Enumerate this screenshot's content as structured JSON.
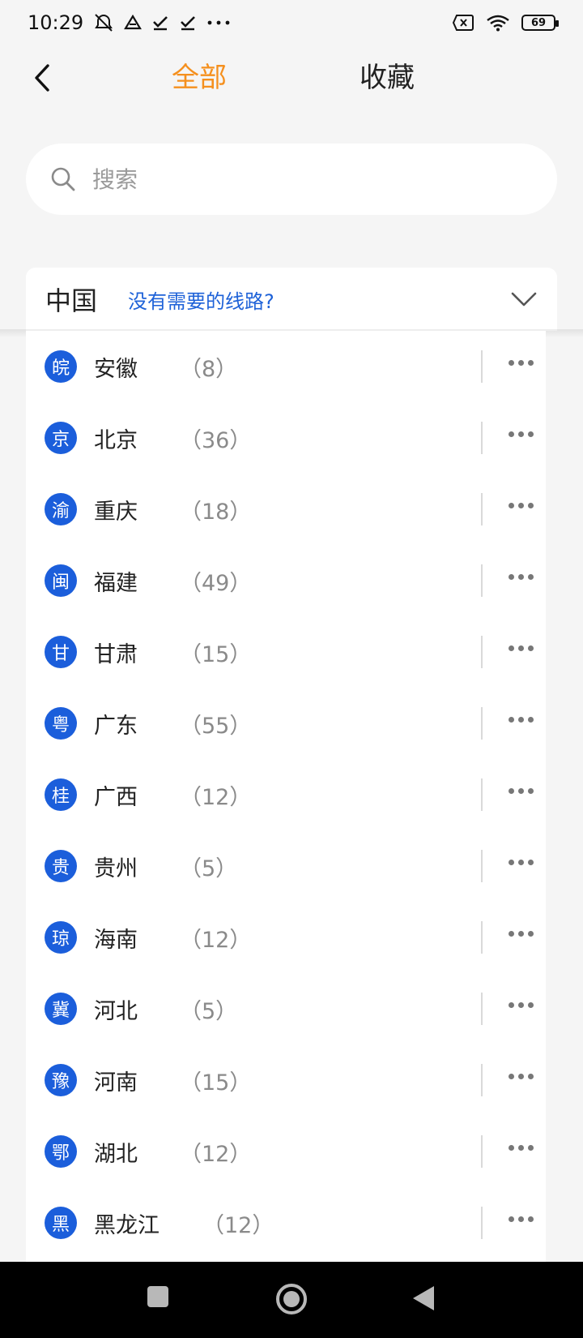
{
  "status_bar": {
    "time": "10:29",
    "battery": "69",
    "icons": [
      "alarm-off-icon",
      "drive-icon",
      "check-icon",
      "check-icon",
      "more-dots-icon",
      "sim-x-icon",
      "wifi-icon",
      "battery-icon"
    ]
  },
  "header": {
    "back_icon": "back-arrow-icon",
    "tabs": [
      {
        "label": "全部",
        "active": true
      },
      {
        "label": "收藏",
        "active": false
      }
    ],
    "active_color": "#f5901e"
  },
  "search": {
    "placeholder": "搜索",
    "icon": "search-icon"
  },
  "region": {
    "name": "中国",
    "link_text": "没有需要的线路?",
    "chevron": "chevron-down-icon",
    "link_color": "#1e62d8"
  },
  "provinces": [
    {
      "badge": "皖",
      "name": "安徽",
      "count": "（8）"
    },
    {
      "badge": "京",
      "name": "北京",
      "count": "（36）"
    },
    {
      "badge": "渝",
      "name": "重庆",
      "count": "（18）"
    },
    {
      "badge": "闽",
      "name": "福建",
      "count": "（49）"
    },
    {
      "badge": "甘",
      "name": "甘肃",
      "count": "（15）"
    },
    {
      "badge": "粤",
      "name": "广东",
      "count": "（55）"
    },
    {
      "badge": "桂",
      "name": "广西",
      "count": "（12）"
    },
    {
      "badge": "贵",
      "name": "贵州",
      "count": "（5）"
    },
    {
      "badge": "琼",
      "name": "海南",
      "count": "（12）"
    },
    {
      "badge": "冀",
      "name": "河北",
      "count": "（5）"
    },
    {
      "badge": "豫",
      "name": "河南",
      "count": "（15）"
    },
    {
      "badge": "鄂",
      "name": "湖北",
      "count": "（12）"
    },
    {
      "badge": "黑",
      "name": "黑龙江",
      "count": "（12）"
    }
  ],
  "badge_color": "#1b5edb",
  "nav": [
    "square-icon",
    "home-circle-icon",
    "back-triangle-icon"
  ]
}
